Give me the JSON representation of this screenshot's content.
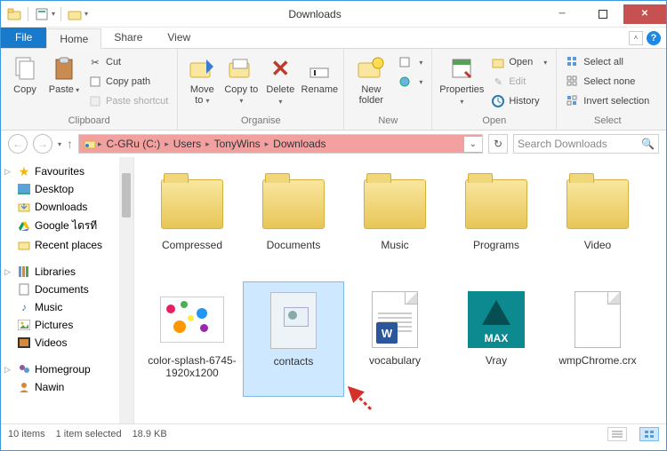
{
  "window": {
    "title": "Downloads"
  },
  "tabs": {
    "file": "File",
    "home": "Home",
    "share": "Share",
    "view": "View"
  },
  "ribbon": {
    "clipboard": {
      "copy": "Copy",
      "paste": "Paste",
      "cut": "Cut",
      "copy_path": "Copy path",
      "paste_shortcut": "Paste shortcut",
      "label": "Clipboard"
    },
    "organise": {
      "move_to": "Move to",
      "copy_to": "Copy to",
      "delete": "Delete",
      "rename": "Rename",
      "label": "Organise"
    },
    "new": {
      "new_folder": "New folder",
      "label": "New"
    },
    "open": {
      "properties": "Properties",
      "open": "Open",
      "edit": "Edit",
      "history": "History",
      "label": "Open"
    },
    "select": {
      "select_all": "Select all",
      "select_none": "Select none",
      "invert": "Invert selection",
      "label": "Select"
    }
  },
  "breadcrumb": {
    "items": [
      "C-GRu (C:)",
      "Users",
      "TonyWins",
      "Downloads"
    ]
  },
  "search": {
    "placeholder": "Search Downloads"
  },
  "sidebar": {
    "favourites": "Favourites",
    "desktop": "Desktop",
    "downloads": "Downloads",
    "google": "Google ไดรที",
    "recent": "Recent places",
    "libraries": "Libraries",
    "documents": "Documents",
    "music": "Music",
    "pictures": "Pictures",
    "videos": "Videos",
    "homegroup": "Homegroup",
    "user": "Nawin"
  },
  "items": [
    {
      "name": "Compressed",
      "type": "folder"
    },
    {
      "name": "Documents",
      "type": "folder"
    },
    {
      "name": "Music",
      "type": "folder"
    },
    {
      "name": "Programs",
      "type": "folder"
    },
    {
      "name": "Video",
      "type": "folder"
    },
    {
      "name": "color-splash-6745-1920x1200",
      "type": "image"
    },
    {
      "name": "contacts",
      "type": "contact",
      "selected": true
    },
    {
      "name": "vocabulary",
      "type": "word"
    },
    {
      "name": "Vray",
      "type": "max"
    },
    {
      "name": "wmpChrome.crx",
      "type": "file"
    }
  ],
  "status": {
    "count": "10 items",
    "selected": "1 item selected",
    "size": "18.9 KB"
  }
}
